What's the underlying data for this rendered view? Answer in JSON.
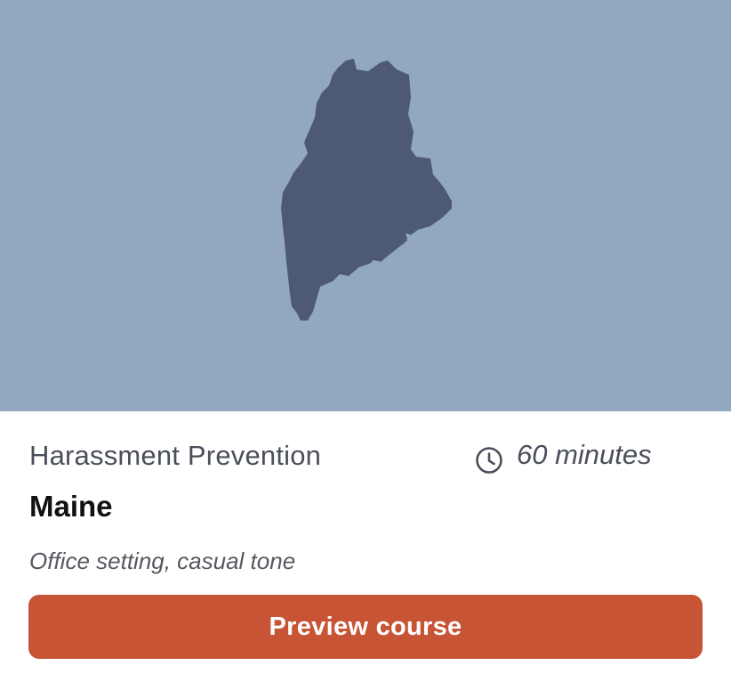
{
  "colors": {
    "hero_background": "#91a8c0",
    "map_shape": "#4e5a73",
    "button_background": "#c75434",
    "button_text": "#ffffff"
  },
  "hero": {
    "illustration": "maine-state-map"
  },
  "course": {
    "type": "Harassment Prevention",
    "duration_icon": "clock-icon",
    "duration": "60 minutes",
    "state": "Maine",
    "setting": "Office setting, casual tone"
  },
  "actions": {
    "preview_label": "Preview course"
  }
}
